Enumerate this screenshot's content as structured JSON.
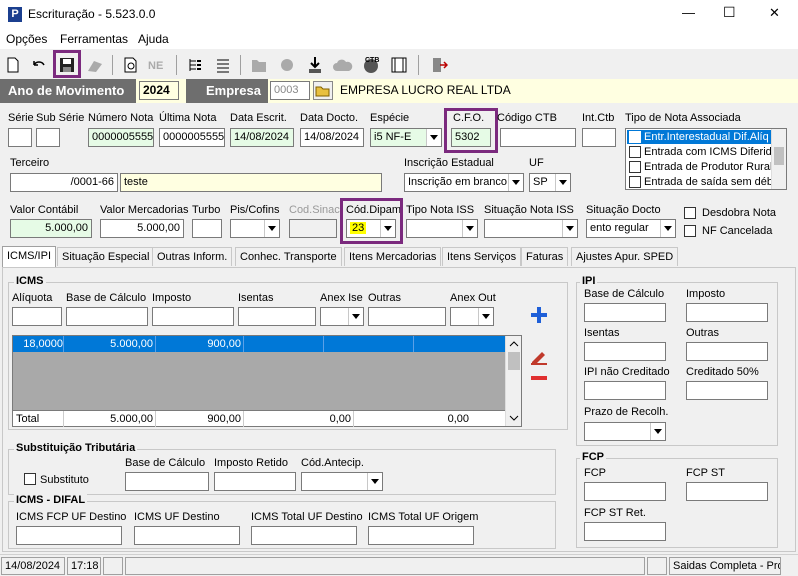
{
  "window": {
    "title": "Escrituração - 5.523.0.0",
    "minimize": "—",
    "maximize": "☐",
    "close": "✕",
    "app_icon_letter": "P"
  },
  "menu": [
    "Opções",
    "Ferramentas",
    "Ajuda"
  ],
  "top": {
    "ano_label": "Ano de Movimento",
    "ano_value": "2024",
    "empresa_label": "Empresa",
    "empresa_code": "0003",
    "empresa_name": "EMPRESA LUCRO REAL LTDA"
  },
  "fields": {
    "serie_label": "Série",
    "subserie_label": "Sub Série",
    "numero_nota_label": "Número Nota",
    "numero_nota": "0000005555",
    "ultima_nota_label": "Última Nota",
    "ultima_nota": "0000005555",
    "data_escrit_label": "Data Escrit.",
    "data_escrit": "14/08/2024",
    "data_docto_label": "Data Docto.",
    "data_docto": "14/08/2024",
    "especie_label": "Espécie",
    "especie": "i5  NF-E",
    "cfo_label": "C.F.O.",
    "cfo": "5302",
    "codigo_ctb_label": "Código CTB",
    "int_ctb_label": "Int.Ctb",
    "tipo_nota_assoc_label": "Tipo de Nota Associada",
    "tipo_nota_assoc_items": [
      "Entr.Interestadual Dif.Alíq",
      "Entrada com ICMS Diferido",
      "Entrada de Produtor Rural",
      "Entrada de saída sem débi"
    ],
    "terceiro_label": "Terceiro",
    "terceiro_cnpj": "/0001-66",
    "terceiro_nome": "teste",
    "inscricao_label": "Inscrição Estadual",
    "inscricao": "Inscrição em branco",
    "uf_label": "UF",
    "uf": "SP",
    "valor_contabil_label": "Valor Contábil",
    "valor_contabil": "5.000,00",
    "valor_merc_label": "Valor Mercadorias",
    "valor_merc": "5.000,00",
    "turbo_label": "Turbo",
    "pis_label": "Pis/Cofins",
    "cod_sinac_label": "Cod.Sinac",
    "cod_dipam_label": "Cód.Dipam",
    "cod_dipam": "23",
    "tipo_iss_label": "Tipo Nota ISS",
    "situacao_iss_label": "Situação Nota ISS",
    "situacao_docto_label": "Situação Docto",
    "situacao_docto": "ento regular",
    "desdobra_label": "Desdobra Nota",
    "nf_cancelada_label": "NF Cancelada"
  },
  "tabs": [
    "ICMS/IPI",
    "Situação Especial",
    "Outras Inform.",
    "Conhec. Transporte",
    "Itens Mercadorias",
    "Itens Serviços",
    "Faturas",
    "Ajustes Apur. SPED"
  ],
  "icms": {
    "title": "ICMS",
    "cols": [
      "Alíquota",
      "Base de Cálculo",
      "Imposto",
      "Isentas",
      "Anex Ise",
      "Outras",
      "Anex Out"
    ],
    "row": {
      "aliquota": "18,0000",
      "base": "5.000,00",
      "imposto": "900,00"
    },
    "total": {
      "label": "Total",
      "base": "5.000,00",
      "imposto": "900,00",
      "isentas": "0,00",
      "outras": "0,00"
    }
  },
  "ipi": {
    "title": "IPI",
    "base_label": "Base de Cálculo",
    "imposto_label": "Imposto",
    "isentas_label": "Isentas",
    "outras_label": "Outras",
    "nao_cred_label": "IPI não Creditado",
    "cred50_label": "Creditado 50%",
    "prazo_label": "Prazo de Recolh."
  },
  "st": {
    "title": "Substituição Tributária",
    "substituto_label": "Substituto",
    "base_label": "Base de Cálculo",
    "retido_label": "Imposto Retido",
    "antecip_label": "Cód.Antecip."
  },
  "difal": {
    "title": "ICMS - DIFAL",
    "fcp_uf_label": "ICMS FCP UF Destino",
    "uf_dest_label": "ICMS UF Destino",
    "total_dest_label": "ICMS Total UF Destino",
    "total_orig_label": "ICMS Total UF Origem"
  },
  "fcp": {
    "title": "FCP",
    "fcp_label": "FCP",
    "fcp_st_label": "FCP ST",
    "fcp_st_ret_label": "FCP ST Ret."
  },
  "status": {
    "date": "14/08/2024",
    "time": "17:18",
    "message": "Saidas Completa - Pros"
  }
}
